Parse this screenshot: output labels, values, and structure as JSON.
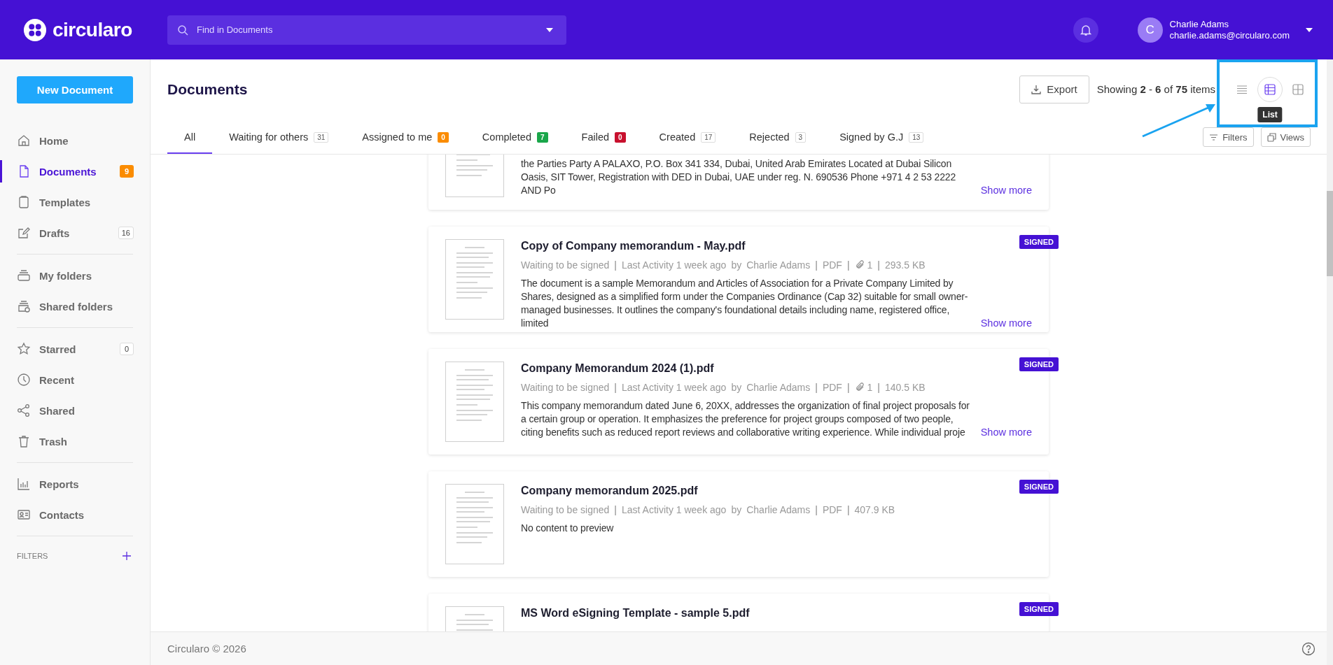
{
  "header": {
    "logo": "circularo",
    "search": {
      "placeholder": "Find in Documents"
    },
    "user": {
      "initial": "C",
      "name": "Charlie Adams",
      "email": "charlie.adams@circularo.com"
    }
  },
  "sidebar": {
    "new_button": "New Document",
    "groups": [
      [
        {
          "label": "Home",
          "selected": false
        },
        {
          "label": "Documents",
          "selected": true,
          "badge": "9",
          "color": "#fb8c00"
        },
        {
          "label": "Templates",
          "selected": false
        },
        {
          "label": "Drafts",
          "selected": false,
          "badge": "16"
        }
      ],
      [
        {
          "label": "My folders",
          "selected": false
        },
        {
          "label": "Shared folders",
          "selected": false
        }
      ],
      [
        {
          "label": "Starred",
          "selected": false,
          "badge": "0"
        },
        {
          "label": "Recent",
          "selected": false
        },
        {
          "label": "Shared",
          "selected": false
        },
        {
          "label": "Trash",
          "selected": false
        }
      ],
      [
        {
          "label": "Reports",
          "selected": false
        },
        {
          "label": "Contacts",
          "selected": false
        }
      ]
    ],
    "filters_label": "FILTERS"
  },
  "page": {
    "title": "Documents",
    "export": "Export",
    "showing": "Showing **2** - **6** of **75** items",
    "views": [
      {
        "selected": false
      },
      {
        "selected": true
      },
      {
        "selected": false
      }
    ],
    "tooltip": "List"
  },
  "tabs": [
    {
      "label": "All",
      "selected": true
    },
    {
      "label": "Waiting for others",
      "selected": false,
      "badge": "31"
    },
    {
      "label": "Assigned to me",
      "selected": false,
      "badge": "0",
      "color": "#fb8c00"
    },
    {
      "label": "Completed",
      "selected": false,
      "badge": "7",
      "color": "#1aa64a"
    },
    {
      "label": "Failed",
      "selected": false,
      "badge": "0",
      "color": "#c8102e"
    },
    {
      "label": "Created",
      "selected": false,
      "badge": "17"
    },
    {
      "label": "Rejected",
      "selected": false,
      "badge": "3"
    },
    {
      "label": "Signed by G.J",
      "selected": false,
      "badge": "13"
    }
  ],
  "filters_button": "Filters",
  "views_button": "Views",
  "documents": [
    {
      "description": "the Parties Party A PALAXO, P.O. Box 341 334, Dubai, United Arab Emirates Located at Dubai Silicon Oasis, SIT Tower, Registration with DED in Dubai, UAE under reg. N. 690536 Phone +971 4 2 53 2222 AND Po",
      "show_more": "Show more"
    },
    {
      "title": "Copy of Company memorandum - May.pdf",
      "badge": "SIGNED",
      "meta": [
        {
          "kind": "text",
          "text": "Waiting to be signed"
        },
        {
          "kind": "sep",
          "text": "|"
        },
        {
          "kind": "text",
          "text": "Last Activity 1 week ago"
        },
        {
          "kind": "text",
          "text": "by"
        },
        {
          "kind": "text",
          "text": "Charlie Adams"
        },
        {
          "kind": "sep",
          "text": "|"
        },
        {
          "kind": "text",
          "text": "PDF"
        },
        {
          "kind": "sep",
          "text": "|"
        },
        {
          "kind": "attachment",
          "text": "1"
        },
        {
          "kind": "sep",
          "text": "|"
        },
        {
          "kind": "text",
          "text": "293.5 KB"
        }
      ],
      "description": "The document is a sample Memorandum and Articles of Association for a Private Company Limited by Shares, designed as a simplified form under the Companies Ordinance (Cap 32) suitable for small owner-managed businesses. It outlines the company's foundational details including name, registered office, limited",
      "show_more": "Show more"
    },
    {
      "title": "Company Memorandum 2024 (1).pdf",
      "badge": "SIGNED",
      "meta": [
        {
          "kind": "text",
          "text": "Waiting to be signed"
        },
        {
          "kind": "sep",
          "text": "|"
        },
        {
          "kind": "text",
          "text": "Last Activity 1 week ago"
        },
        {
          "kind": "text",
          "text": "by"
        },
        {
          "kind": "text",
          "text": "Charlie Adams"
        },
        {
          "kind": "sep",
          "text": "|"
        },
        {
          "kind": "text",
          "text": "PDF"
        },
        {
          "kind": "sep",
          "text": "|"
        },
        {
          "kind": "attachment",
          "text": "1"
        },
        {
          "kind": "sep",
          "text": "|"
        },
        {
          "kind": "text",
          "text": "140.5 KB"
        }
      ],
      "description": "This company memorandum dated June 6, 20XX, addresses the organization of final project proposals for a certain group or operation. It emphasizes the preference for project groups composed of two people, citing benefits such as reduced report reviews and collaborative writing experience. While individual proje",
      "show_more": "Show more"
    },
    {
      "title": "Company memorandum 2025.pdf",
      "badge": "SIGNED",
      "meta": [
        {
          "kind": "text",
          "text": "Waiting to be signed"
        },
        {
          "kind": "sep",
          "text": "|"
        },
        {
          "kind": "text",
          "text": "Last Activity 1 week ago"
        },
        {
          "kind": "text",
          "text": "by"
        },
        {
          "kind": "text",
          "text": "Charlie Adams"
        },
        {
          "kind": "sep",
          "text": "|"
        },
        {
          "kind": "text",
          "text": "PDF"
        },
        {
          "kind": "sep",
          "text": "|"
        },
        {
          "kind": "text",
          "text": "407.9 KB"
        }
      ],
      "description": "No content to preview"
    },
    {
      "title": "MS Word eSigning Template - sample 5.pdf",
      "badge": "SIGNED"
    }
  ],
  "footer": {
    "copyright": "Circularo © 2026"
  }
}
